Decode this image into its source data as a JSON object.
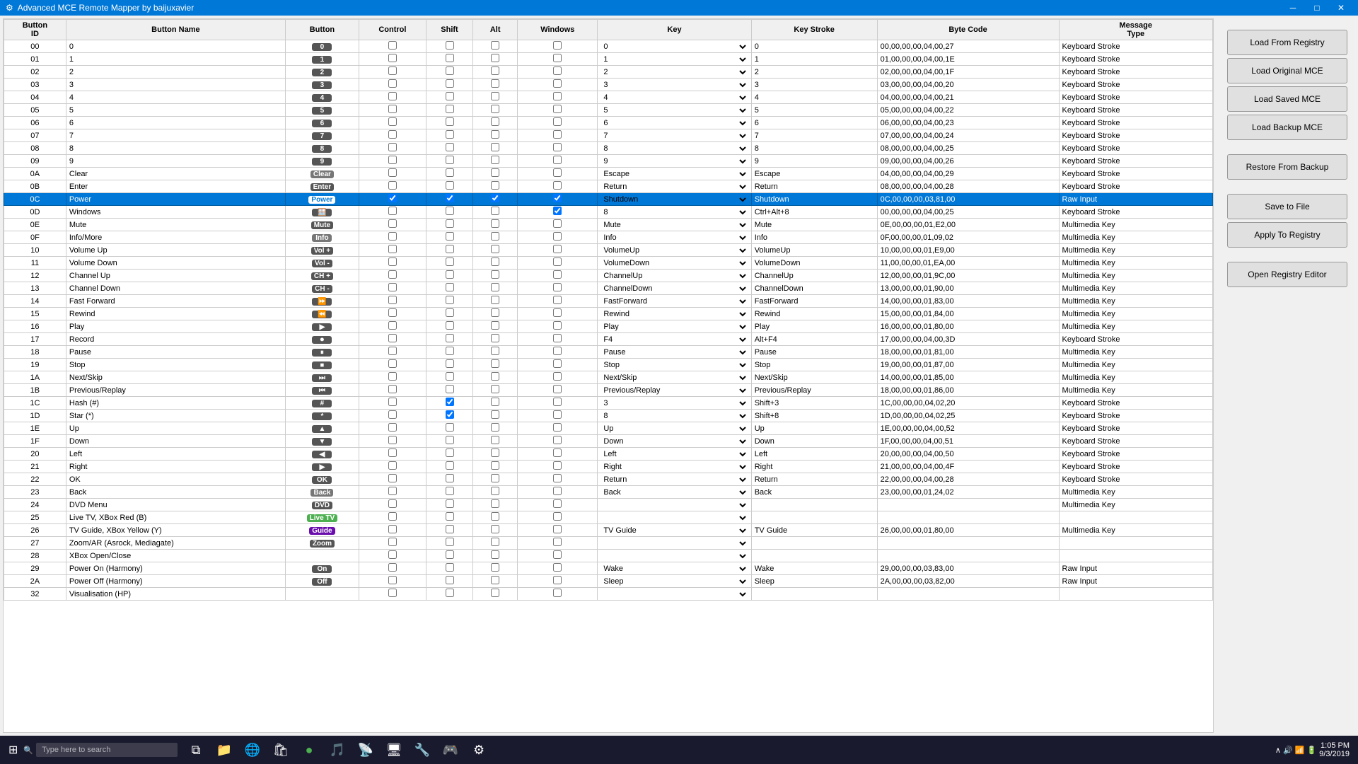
{
  "window": {
    "title": "Advanced MCE Remote Mapper by baijuxavier",
    "icon": "⚙"
  },
  "columns": {
    "button_id": "Button ID",
    "button_name": "Button Name",
    "button": "Button",
    "control": "Control",
    "shift": "Shift",
    "alt": "Alt",
    "windows": "Windows",
    "key": "Key",
    "key_stroke": "Key Stroke",
    "byte_code": "Byte Code",
    "message_type": "Message Type"
  },
  "rows": [
    {
      "id": "00",
      "name": "0",
      "btn_label": "0",
      "ctrl": false,
      "shift": false,
      "alt": false,
      "win": false,
      "key": "0",
      "keystroke": "0",
      "bytecode": "00,00,00,00,04,00,27",
      "msgtype": "Keyboard Stroke",
      "selected": false
    },
    {
      "id": "01",
      "name": "1",
      "btn_label": "1",
      "ctrl": false,
      "shift": false,
      "alt": false,
      "win": false,
      "key": "1",
      "keystroke": "1",
      "bytecode": "01,00,00,00,04,00,1E",
      "msgtype": "Keyboard Stroke",
      "selected": false
    },
    {
      "id": "02",
      "name": "2",
      "btn_label": "2",
      "ctrl": false,
      "shift": false,
      "alt": false,
      "win": false,
      "key": "2",
      "keystroke": "2",
      "bytecode": "02,00,00,00,04,00,1F",
      "msgtype": "Keyboard Stroke",
      "selected": false
    },
    {
      "id": "03",
      "name": "3",
      "btn_label": "3",
      "ctrl": false,
      "shift": false,
      "alt": false,
      "win": false,
      "key": "3",
      "keystroke": "3",
      "bytecode": "03,00,00,00,04,00,20",
      "msgtype": "Keyboard Stroke",
      "selected": false
    },
    {
      "id": "04",
      "name": "4",
      "btn_label": "4",
      "ctrl": false,
      "shift": false,
      "alt": false,
      "win": false,
      "key": "4",
      "keystroke": "4",
      "bytecode": "04,00,00,00,04,00,21",
      "msgtype": "Keyboard Stroke",
      "selected": false
    },
    {
      "id": "05",
      "name": "5",
      "btn_label": "5",
      "ctrl": false,
      "shift": false,
      "alt": false,
      "win": false,
      "key": "5",
      "keystroke": "5",
      "bytecode": "05,00,00,00,04,00,22",
      "msgtype": "Keyboard Stroke",
      "selected": false
    },
    {
      "id": "06",
      "name": "6",
      "btn_label": "6",
      "ctrl": false,
      "shift": false,
      "alt": false,
      "win": false,
      "key": "6",
      "keystroke": "6",
      "bytecode": "06,00,00,00,04,00,23",
      "msgtype": "Keyboard Stroke",
      "selected": false
    },
    {
      "id": "07",
      "name": "7",
      "btn_label": "7",
      "ctrl": false,
      "shift": false,
      "alt": false,
      "win": false,
      "key": "7",
      "keystroke": "7",
      "bytecode": "07,00,00,00,04,00,24",
      "msgtype": "Keyboard Stroke",
      "selected": false
    },
    {
      "id": "08",
      "name": "8",
      "btn_label": "8",
      "ctrl": false,
      "shift": false,
      "alt": false,
      "win": false,
      "key": "8",
      "keystroke": "8",
      "bytecode": "08,00,00,00,04,00,25",
      "msgtype": "Keyboard Stroke",
      "selected": false
    },
    {
      "id": "09",
      "name": "9",
      "btn_label": "9",
      "ctrl": false,
      "shift": false,
      "alt": false,
      "win": false,
      "key": "9",
      "keystroke": "9",
      "bytecode": "09,00,00,00,04,00,26",
      "msgtype": "Keyboard Stroke",
      "selected": false
    },
    {
      "id": "0A",
      "name": "Clear",
      "btn_label": "Clear",
      "ctrl": false,
      "shift": false,
      "alt": false,
      "win": false,
      "key": "Escape",
      "keystroke": "Escape",
      "bytecode": "04,00,00,00,04,00,29",
      "msgtype": "Keyboard Stroke",
      "selected": false
    },
    {
      "id": "0B",
      "name": "Enter",
      "btn_label": "Enter",
      "ctrl": false,
      "shift": false,
      "alt": false,
      "win": false,
      "key": "Return",
      "keystroke": "Return",
      "bytecode": "08,00,00,00,04,00,28",
      "msgtype": "Keyboard Stroke",
      "selected": false
    },
    {
      "id": "0C",
      "name": "Power",
      "btn_label": "Power",
      "ctrl": true,
      "shift": true,
      "alt": true,
      "win": true,
      "key": "Shutdown",
      "keystroke": "Shutdown",
      "bytecode": "0C,00,00,00,03,81,00",
      "msgtype": "Raw Input",
      "selected": true
    },
    {
      "id": "0D",
      "name": "Windows",
      "btn_label": "🪟",
      "ctrl": false,
      "shift": false,
      "alt": false,
      "win": true,
      "key": "8",
      "keystroke": "Ctrl+Alt+8",
      "bytecode": "00,00,00,00,04,00,25",
      "msgtype": "Keyboard Stroke",
      "selected": false
    },
    {
      "id": "0E",
      "name": "Mute",
      "btn_label": "Mute",
      "ctrl": false,
      "shift": false,
      "alt": false,
      "win": false,
      "key": "Mute",
      "keystroke": "Mute",
      "bytecode": "0E,00,00,00,01,E2,00",
      "msgtype": "Multimedia Key",
      "selected": false
    },
    {
      "id": "0F",
      "name": "Info/More",
      "btn_label": "Info",
      "ctrl": false,
      "shift": false,
      "alt": false,
      "win": false,
      "key": "Info",
      "keystroke": "Info",
      "bytecode": "0F,00,00,00,01,09,02",
      "msgtype": "Multimedia Key",
      "selected": false
    },
    {
      "id": "10",
      "name": "Volume Up",
      "btn_label": "Vol +",
      "ctrl": false,
      "shift": false,
      "alt": false,
      "win": false,
      "key": "VolumeUp",
      "keystroke": "VolumeUp",
      "bytecode": "10,00,00,00,01,E9,00",
      "msgtype": "Multimedia Key",
      "selected": false
    },
    {
      "id": "11",
      "name": "Volume Down",
      "btn_label": "Vol -",
      "ctrl": false,
      "shift": false,
      "alt": false,
      "win": false,
      "key": "VolumeDown",
      "keystroke": "VolumeDown",
      "bytecode": "11,00,00,00,01,EA,00",
      "msgtype": "Multimedia Key",
      "selected": false
    },
    {
      "id": "12",
      "name": "Channel Up",
      "btn_label": "CH +",
      "ctrl": false,
      "shift": false,
      "alt": false,
      "win": false,
      "key": "ChannelUp",
      "keystroke": "ChannelUp",
      "bytecode": "12,00,00,00,01,9C,00",
      "msgtype": "Multimedia Key",
      "selected": false
    },
    {
      "id": "13",
      "name": "Channel Down",
      "btn_label": "CH -",
      "ctrl": false,
      "shift": false,
      "alt": false,
      "win": false,
      "key": "ChannelDown",
      "keystroke": "ChannelDown",
      "bytecode": "13,00,00,00,01,90,00",
      "msgtype": "Multimedia Key",
      "selected": false
    },
    {
      "id": "14",
      "name": "Fast Forward",
      "btn_label": "⏩",
      "ctrl": false,
      "shift": false,
      "alt": false,
      "win": false,
      "key": "FastForward",
      "keystroke": "FastForward",
      "bytecode": "14,00,00,00,01,83,00",
      "msgtype": "Multimedia Key",
      "selected": false
    },
    {
      "id": "15",
      "name": "Rewind",
      "btn_label": "⏪",
      "ctrl": false,
      "shift": false,
      "alt": false,
      "win": false,
      "key": "Rewind",
      "keystroke": "Rewind",
      "bytecode": "15,00,00,00,01,84,00",
      "msgtype": "Multimedia Key",
      "selected": false
    },
    {
      "id": "16",
      "name": "Play",
      "btn_label": "▶",
      "ctrl": false,
      "shift": false,
      "alt": false,
      "win": false,
      "key": "Play",
      "keystroke": "Play",
      "bytecode": "16,00,00,00,01,80,00",
      "msgtype": "Multimedia Key",
      "selected": false
    },
    {
      "id": "17",
      "name": "Record",
      "btn_label": "⏺",
      "ctrl": false,
      "shift": false,
      "alt": false,
      "win": false,
      "key": "F4",
      "keystroke": "Alt+F4",
      "bytecode": "17,00,00,00,04,00,3D",
      "msgtype": "Keyboard Stroke",
      "selected": false
    },
    {
      "id": "18",
      "name": "Pause",
      "btn_label": "⏸",
      "ctrl": false,
      "shift": false,
      "alt": false,
      "win": false,
      "key": "Pause",
      "keystroke": "Pause",
      "bytecode": "18,00,00,00,01,81,00",
      "msgtype": "Multimedia Key",
      "selected": false
    },
    {
      "id": "19",
      "name": "Stop",
      "btn_label": "⏹",
      "ctrl": false,
      "shift": false,
      "alt": false,
      "win": false,
      "key": "Stop",
      "keystroke": "Stop",
      "bytecode": "19,00,00,00,01,87,00",
      "msgtype": "Multimedia Key",
      "selected": false
    },
    {
      "id": "1A",
      "name": "Next/Skip",
      "btn_label": "⏭",
      "ctrl": false,
      "shift": false,
      "alt": false,
      "win": false,
      "key": "Next/Skip",
      "keystroke": "Next/Skip",
      "bytecode": "14,00,00,00,01,85,00",
      "msgtype": "Multimedia Key",
      "selected": false
    },
    {
      "id": "1B",
      "name": "Previous/Replay",
      "btn_label": "⏮",
      "ctrl": false,
      "shift": false,
      "alt": false,
      "win": false,
      "key": "Previous/Replay",
      "keystroke": "Previous/Replay",
      "bytecode": "18,00,00,00,01,86,00",
      "msgtype": "Multimedia Key",
      "selected": false
    },
    {
      "id": "1C",
      "name": "Hash (#)",
      "btn_label": "#",
      "ctrl": false,
      "shift": true,
      "alt": false,
      "win": false,
      "key": "3",
      "keystroke": "Shift+3",
      "bytecode": "1C,00,00,00,04,02,20",
      "msgtype": "Keyboard Stroke",
      "selected": false
    },
    {
      "id": "1D",
      "name": "Star (*)",
      "btn_label": "*",
      "ctrl": false,
      "shift": true,
      "alt": false,
      "win": false,
      "key": "8",
      "keystroke": "Shift+8",
      "bytecode": "1D,00,00,00,04,02,25",
      "msgtype": "Keyboard Stroke",
      "selected": false
    },
    {
      "id": "1E",
      "name": "Up",
      "btn_label": "▲",
      "ctrl": false,
      "shift": false,
      "alt": false,
      "win": false,
      "key": "Up",
      "keystroke": "Up",
      "bytecode": "1E,00,00,00,04,00,52",
      "msgtype": "Keyboard Stroke",
      "selected": false
    },
    {
      "id": "1F",
      "name": "Down",
      "btn_label": "▼",
      "ctrl": false,
      "shift": false,
      "alt": false,
      "win": false,
      "key": "Down",
      "keystroke": "Down",
      "bytecode": "1F,00,00,00,04,00,51",
      "msgtype": "Keyboard Stroke",
      "selected": false
    },
    {
      "id": "20",
      "name": "Left",
      "btn_label": "◀",
      "ctrl": false,
      "shift": false,
      "alt": false,
      "win": false,
      "key": "Left",
      "keystroke": "Left",
      "bytecode": "20,00,00,00,04,00,50",
      "msgtype": "Keyboard Stroke",
      "selected": false
    },
    {
      "id": "21",
      "name": "Right",
      "btn_label": "▶",
      "ctrl": false,
      "shift": false,
      "alt": false,
      "win": false,
      "key": "Right",
      "keystroke": "Right",
      "bytecode": "21,00,00,00,04,00,4F",
      "msgtype": "Keyboard Stroke",
      "selected": false
    },
    {
      "id": "22",
      "name": "OK",
      "btn_label": "OK",
      "ctrl": false,
      "shift": false,
      "alt": false,
      "win": false,
      "key": "Return",
      "keystroke": "Return",
      "bytecode": "22,00,00,00,04,00,28",
      "msgtype": "Keyboard Stroke",
      "selected": false
    },
    {
      "id": "23",
      "name": "Back",
      "btn_label": "Back",
      "ctrl": false,
      "shift": false,
      "alt": false,
      "win": false,
      "key": "Back",
      "keystroke": "Back",
      "bytecode": "23,00,00,00,01,24,02",
      "msgtype": "Multimedia Key",
      "selected": false
    },
    {
      "id": "24",
      "name": "DVD Menu",
      "btn_label": "DVD",
      "ctrl": false,
      "shift": false,
      "alt": false,
      "win": false,
      "key": "",
      "keystroke": "",
      "bytecode": "",
      "msgtype": "Multimedia Key",
      "selected": false
    },
    {
      "id": "25",
      "name": "Live TV, XBox Red (B)",
      "btn_label": "Live TV",
      "ctrl": false,
      "shift": false,
      "alt": false,
      "win": false,
      "key": "",
      "keystroke": "",
      "bytecode": "",
      "msgtype": "",
      "selected": false
    },
    {
      "id": "26",
      "name": "TV Guide, XBox Yellow (Y)",
      "btn_label": "Guide",
      "ctrl": false,
      "shift": false,
      "alt": false,
      "win": false,
      "key": "TV Guide",
      "keystroke": "TV Guide",
      "bytecode": "26,00,00,00,01,80,00",
      "msgtype": "Multimedia Key",
      "selected": false
    },
    {
      "id": "27",
      "name": "Zoom/AR (Asrock, Mediagate)",
      "btn_label": "Zoom",
      "ctrl": false,
      "shift": false,
      "alt": false,
      "win": false,
      "key": "",
      "keystroke": "",
      "bytecode": "",
      "msgtype": "",
      "selected": false
    },
    {
      "id": "28",
      "name": "XBox Open/Close",
      "btn_label": "",
      "ctrl": false,
      "shift": false,
      "alt": false,
      "win": false,
      "key": "",
      "keystroke": "",
      "bytecode": "",
      "msgtype": "",
      "selected": false
    },
    {
      "id": "29",
      "name": "Power On (Harmony)",
      "btn_label": "On",
      "ctrl": false,
      "shift": false,
      "alt": false,
      "win": false,
      "key": "Wake",
      "keystroke": "Wake",
      "bytecode": "29,00,00,00,03,83,00",
      "msgtype": "Raw Input",
      "selected": false
    },
    {
      "id": "2A",
      "name": "Power Off (Harmony)",
      "btn_label": "Off",
      "ctrl": false,
      "shift": false,
      "alt": false,
      "win": false,
      "key": "Sleep",
      "keystroke": "Sleep",
      "bytecode": "2A,00,00,00,03,82,00",
      "msgtype": "Raw Input",
      "selected": false
    },
    {
      "id": "32",
      "name": "Visualisation (HP)",
      "btn_label": "",
      "ctrl": false,
      "shift": false,
      "alt": false,
      "win": false,
      "key": "",
      "keystroke": "",
      "bytecode": "",
      "msgtype": "",
      "selected": false
    }
  ],
  "side_panel": {
    "load_from_registry": "Load From Registry",
    "load_original_mce": "Load Original MCE",
    "load_saved_mce": "Load Saved MCE",
    "load_backup_mce": "Load Backup MCE",
    "restore_from_backup": "Restore From Backup",
    "save_to_file": "Save to File",
    "apply_to_registry": "Apply To Registry",
    "open_registry_editor": "Open Registry Editor"
  },
  "taskbar": {
    "search_placeholder": "Type here to search",
    "time": "1:05 PM",
    "date": "9/3/2019"
  }
}
